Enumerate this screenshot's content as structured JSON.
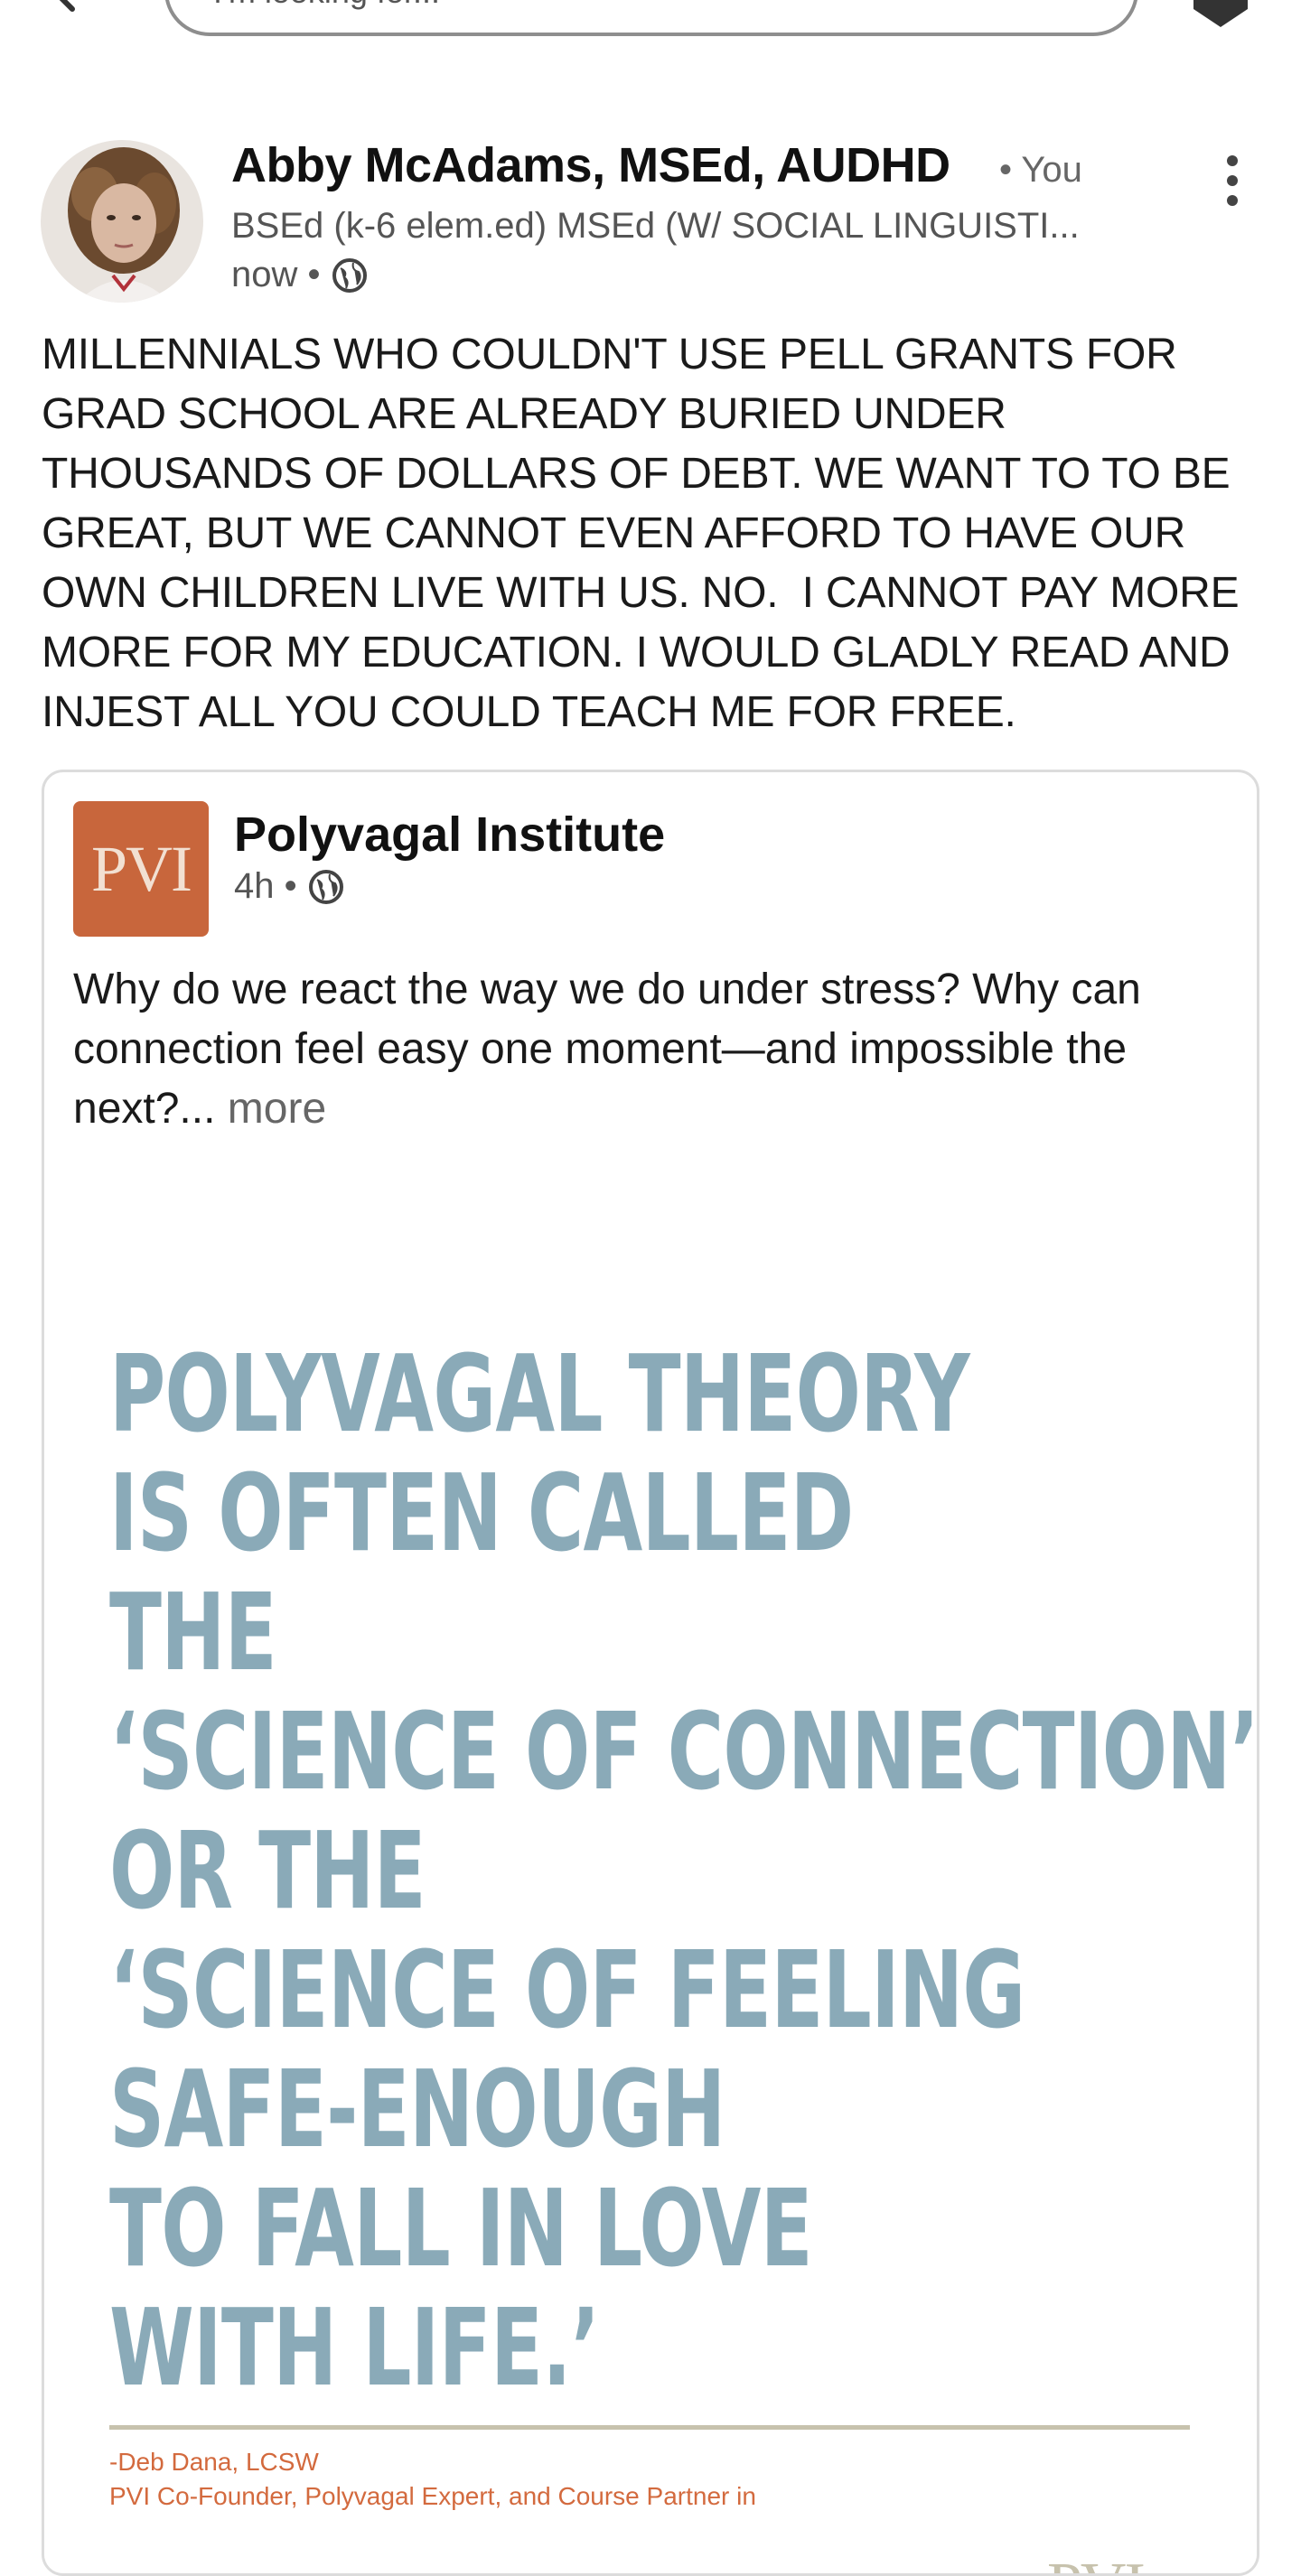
{
  "search": {
    "placeholder": "I'm looking for..."
  },
  "post": {
    "author": {
      "name": "Abby McAdams, MSEd, AUDHD",
      "relation": "• You",
      "headline": "BSEd (k-6 elem.ed) MSEd (W/ SOCIAL LINGUISTI...",
      "time": "now •"
    },
    "body_lines": [
      "MILLENNIALS WHO COULDN'T USE PELL GRANTS FOR",
      "GRAD SCHOOL ARE ALREADY BURIED UNDER",
      "THOUSANDS OF DOLLARS OF DEBT. WE WANT TO TO BE",
      "GREAT, BUT WE CANNOT EVEN AFFORD TO HAVE OUR",
      "OWN CHILDREN LIVE WITH US. NO.  I CANNOT PAY MORE",
      "MORE FOR MY EDUCATION. I WOULD GLADLY READ AND",
      "INJEST ALL YOU COULD TEACH ME FOR FREE."
    ]
  },
  "shared": {
    "logo_text": "PVI",
    "org_name": "Polyvagal Institute",
    "time": "4h •",
    "text_lines": [
      "Why do we react the way we do under stress? Why can",
      "connection feel easy one moment—and impossible the"
    ],
    "text_last": "next?...",
    "more_label": "more",
    "quote_lines": [
      "POLYVAGAL THEORY",
      "IS OFTEN CALLED",
      "THE",
      "‘SCIENCE OF CONNECTION’",
      "OR THE",
      "‘SCIENCE OF FEELING",
      "SAFE-ENOUGH",
      "TO FALL IN LOVE",
      "WITH LIFE.’"
    ],
    "attribution_lines": [
      "-Deb Dana, LCSW",
      "PVI Co-Founder, Polyvagal Expert, and Course Partner in"
    ],
    "watermark": "PVI"
  },
  "colors": {
    "quote_text": "#8aaab8",
    "attribution": "#d36a3e",
    "logo_bg": "#c8663c"
  }
}
